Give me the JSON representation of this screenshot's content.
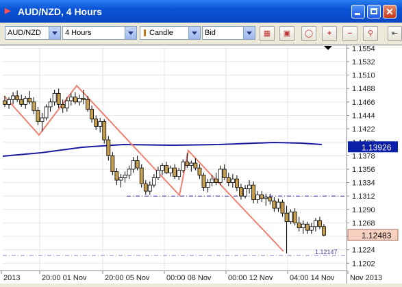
{
  "window": {
    "title": "AUD/NZD,  4 Hours"
  },
  "toolbar": {
    "instrument": "AUD/NZD",
    "timeframe": "4 Hours",
    "chart_type": "Candle",
    "price_side": "Bid",
    "tools": [
      "chart-settings-icon",
      "toggle-indicator-icon",
      "zoom-fit-icon",
      "zoom-in-icon",
      "zoom-out-icon",
      "zoom-reset-icon",
      "pan-left-icon"
    ]
  },
  "chart_data": {
    "type": "candlestick",
    "instrument": "AUD/NZD",
    "y_ticks": [
      "1.1554",
      "1.1532",
      "1.1510",
      "1.1488",
      "1.1466",
      "1.1444",
      "1.1422",
      "1.1400",
      "1.1378",
      "1.1356",
      "1.1334",
      "1.1312",
      "1.1290",
      "1.1268",
      "1.1246",
      "1.1224",
      "1.1202"
    ],
    "ylim": [
      1.119,
      1.156
    ],
    "x_ticks": [
      "2013",
      "20:00 01 Nov",
      "20:00 05 Nov",
      "00:00 08 Nov",
      "00:00 12 Nov",
      "04:00 14 Nov",
      "Nov 2013"
    ],
    "moving_average_value": "1.13926",
    "current_price": "1.12483",
    "support_level_label": "1.12147",
    "horizontal_line_level": 1.1312,
    "colors": {
      "bull": "#ffffff",
      "bear": "#c8a050",
      "moving_average": "#1a1aa0",
      "trend_line": "#f08070",
      "ma_label_bg": "#0a1fa8",
      "price_label_bg": "#f8d0c0"
    },
    "candles": [
      {
        "o": 1.1468,
        "h": 1.1476,
        "l": 1.1458,
        "c": 1.1462
      },
      {
        "o": 1.1462,
        "h": 1.1474,
        "l": 1.1455,
        "c": 1.147
      },
      {
        "o": 1.147,
        "h": 1.1482,
        "l": 1.1462,
        "c": 1.1476
      },
      {
        "o": 1.1476,
        "h": 1.1485,
        "l": 1.1466,
        "c": 1.147
      },
      {
        "o": 1.147,
        "h": 1.1478,
        "l": 1.1458,
        "c": 1.1462
      },
      {
        "o": 1.1462,
        "h": 1.1476,
        "l": 1.1455,
        "c": 1.1472
      },
      {
        "o": 1.1472,
        "h": 1.1484,
        "l": 1.1462,
        "c": 1.1466
      },
      {
        "o": 1.1466,
        "h": 1.1474,
        "l": 1.1446,
        "c": 1.1452
      },
      {
        "o": 1.1452,
        "h": 1.1458,
        "l": 1.1428,
        "c": 1.1434
      },
      {
        "o": 1.1434,
        "h": 1.1448,
        "l": 1.1418,
        "c": 1.144
      },
      {
        "o": 1.144,
        "h": 1.1462,
        "l": 1.1436,
        "c": 1.1458
      },
      {
        "o": 1.1458,
        "h": 1.1472,
        "l": 1.145,
        "c": 1.1466
      },
      {
        "o": 1.1466,
        "h": 1.1486,
        "l": 1.146,
        "c": 1.148
      },
      {
        "o": 1.148,
        "h": 1.1488,
        "l": 1.1456,
        "c": 1.1462
      },
      {
        "o": 1.1462,
        "h": 1.147,
        "l": 1.1448,
        "c": 1.1456
      },
      {
        "o": 1.1456,
        "h": 1.1474,
        "l": 1.145,
        "c": 1.1468
      },
      {
        "o": 1.1468,
        "h": 1.148,
        "l": 1.146,
        "c": 1.1474
      },
      {
        "o": 1.1474,
        "h": 1.1482,
        "l": 1.1462,
        "c": 1.1466
      },
      {
        "o": 1.1466,
        "h": 1.1478,
        "l": 1.146,
        "c": 1.1472
      },
      {
        "o": 1.1472,
        "h": 1.1486,
        "l": 1.1462,
        "c": 1.147
      },
      {
        "o": 1.147,
        "h": 1.1476,
        "l": 1.145,
        "c": 1.1454
      },
      {
        "o": 1.1454,
        "h": 1.146,
        "l": 1.1432,
        "c": 1.1438
      },
      {
        "o": 1.1438,
        "h": 1.1444,
        "l": 1.142,
        "c": 1.1426
      },
      {
        "o": 1.1426,
        "h": 1.144,
        "l": 1.1416,
        "c": 1.1434
      },
      {
        "o": 1.1434,
        "h": 1.1438,
        "l": 1.1398,
        "c": 1.1404
      },
      {
        "o": 1.1404,
        "h": 1.141,
        "l": 1.137,
        "c": 1.1378
      },
      {
        "o": 1.1378,
        "h": 1.1384,
        "l": 1.1346,
        "c": 1.1352
      },
      {
        "o": 1.1352,
        "h": 1.1358,
        "l": 1.133,
        "c": 1.1338
      },
      {
        "o": 1.1338,
        "h": 1.1348,
        "l": 1.1326,
        "c": 1.1342
      },
      {
        "o": 1.1342,
        "h": 1.1352,
        "l": 1.1334,
        "c": 1.1346
      },
      {
        "o": 1.1346,
        "h": 1.1362,
        "l": 1.134,
        "c": 1.1356
      },
      {
        "o": 1.1356,
        "h": 1.1376,
        "l": 1.135,
        "c": 1.137
      },
      {
        "o": 1.137,
        "h": 1.1378,
        "l": 1.1354,
        "c": 1.1358
      },
      {
        "o": 1.1358,
        "h": 1.1364,
        "l": 1.1326,
        "c": 1.1332
      },
      {
        "o": 1.1332,
        "h": 1.1338,
        "l": 1.1314,
        "c": 1.132
      },
      {
        "o": 1.132,
        "h": 1.1336,
        "l": 1.1314,
        "c": 1.133
      },
      {
        "o": 1.133,
        "h": 1.1348,
        "l": 1.1326,
        "c": 1.1342
      },
      {
        "o": 1.1342,
        "h": 1.136,
        "l": 1.1338,
        "c": 1.1354
      },
      {
        "o": 1.1354,
        "h": 1.1366,
        "l": 1.1346,
        "c": 1.1362
      },
      {
        "o": 1.1362,
        "h": 1.1368,
        "l": 1.1348,
        "c": 1.135
      },
      {
        "o": 1.135,
        "h": 1.1362,
        "l": 1.1344,
        "c": 1.1358
      },
      {
        "o": 1.1358,
        "h": 1.1364,
        "l": 1.134,
        "c": 1.1344
      },
      {
        "o": 1.1344,
        "h": 1.1358,
        "l": 1.1338,
        "c": 1.1354
      },
      {
        "o": 1.1354,
        "h": 1.1372,
        "l": 1.135,
        "c": 1.1368
      },
      {
        "o": 1.1368,
        "h": 1.1382,
        "l": 1.1358,
        "c": 1.1362
      },
      {
        "o": 1.1362,
        "h": 1.137,
        "l": 1.1352,
        "c": 1.1366
      },
      {
        "o": 1.1366,
        "h": 1.1374,
        "l": 1.1354,
        "c": 1.1358
      },
      {
        "o": 1.1358,
        "h": 1.1364,
        "l": 1.134,
        "c": 1.1346
      },
      {
        "o": 1.1346,
        "h": 1.135,
        "l": 1.132,
        "c": 1.1326
      },
      {
        "o": 1.1326,
        "h": 1.134,
        "l": 1.1318,
        "c": 1.1334
      },
      {
        "o": 1.1334,
        "h": 1.1346,
        "l": 1.1328,
        "c": 1.134
      },
      {
        "o": 1.134,
        "h": 1.135,
        "l": 1.133,
        "c": 1.1334
      },
      {
        "o": 1.1334,
        "h": 1.1362,
        "l": 1.133,
        "c": 1.1356
      },
      {
        "o": 1.1356,
        "h": 1.1364,
        "l": 1.1338,
        "c": 1.1342
      },
      {
        "o": 1.1342,
        "h": 1.135,
        "l": 1.1328,
        "c": 1.1334
      },
      {
        "o": 1.1334,
        "h": 1.1348,
        "l": 1.1326,
        "c": 1.134
      },
      {
        "o": 1.134,
        "h": 1.1346,
        "l": 1.132,
        "c": 1.1326
      },
      {
        "o": 1.1326,
        "h": 1.1332,
        "l": 1.1306,
        "c": 1.1312
      },
      {
        "o": 1.1312,
        "h": 1.133,
        "l": 1.1308,
        "c": 1.1324
      },
      {
        "o": 1.1324,
        "h": 1.1338,
        "l": 1.1316,
        "c": 1.133
      },
      {
        "o": 1.133,
        "h": 1.1336,
        "l": 1.13,
        "c": 1.1306
      },
      {
        "o": 1.1306,
        "h": 1.132,
        "l": 1.13,
        "c": 1.1314
      },
      {
        "o": 1.1314,
        "h": 1.132,
        "l": 1.1302,
        "c": 1.1308
      },
      {
        "o": 1.1308,
        "h": 1.1316,
        "l": 1.1296,
        "c": 1.131
      },
      {
        "o": 1.131,
        "h": 1.1316,
        "l": 1.1298,
        "c": 1.1304
      },
      {
        "o": 1.1304,
        "h": 1.131,
        "l": 1.1286,
        "c": 1.1292
      },
      {
        "o": 1.1292,
        "h": 1.1308,
        "l": 1.1286,
        "c": 1.1302
      },
      {
        "o": 1.1302,
        "h": 1.1306,
        "l": 1.1278,
        "c": 1.1284
      },
      {
        "o": 1.1284,
        "h": 1.1296,
        "l": 1.1218,
        "c": 1.127
      },
      {
        "o": 1.127,
        "h": 1.129,
        "l": 1.1266,
        "c": 1.1286
      },
      {
        "o": 1.1286,
        "h": 1.1292,
        "l": 1.1264,
        "c": 1.1268
      },
      {
        "o": 1.1268,
        "h": 1.1278,
        "l": 1.1254,
        "c": 1.126
      },
      {
        "o": 1.126,
        "h": 1.1272,
        "l": 1.125,
        "c": 1.1266
      },
      {
        "o": 1.1266,
        "h": 1.127,
        "l": 1.125,
        "c": 1.1256
      },
      {
        "o": 1.1256,
        "h": 1.1268,
        "l": 1.125,
        "c": 1.1262
      },
      {
        "o": 1.1262,
        "h": 1.1276,
        "l": 1.1254,
        "c": 1.1272
      },
      {
        "o": 1.1272,
        "h": 1.1278,
        "l": 1.1258,
        "c": 1.1262
      },
      {
        "o": 1.1262,
        "h": 1.1266,
        "l": 1.1246,
        "c": 1.1248
      }
    ]
  }
}
